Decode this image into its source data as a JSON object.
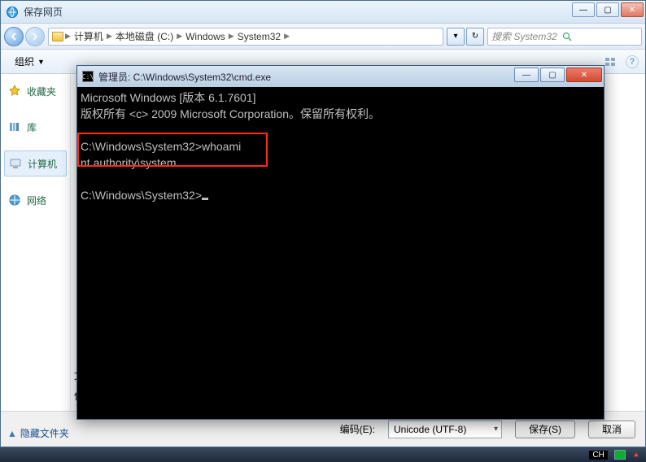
{
  "outer_window": {
    "title": "保存网页"
  },
  "nav": {
    "breadcrumb": [
      "计算机",
      "本地磁盘 (C:)",
      "Windows",
      "System32"
    ],
    "search_placeholder": "搜索 System32"
  },
  "toolbar": {
    "organize": "组织",
    "help_tip": "?"
  },
  "sidebar": {
    "items": [
      {
        "label": "收藏夹",
        "icon": "star"
      },
      {
        "label": "库",
        "icon": "library"
      },
      {
        "label": "计算机",
        "icon": "computer",
        "selected": true
      },
      {
        "label": "网络",
        "icon": "network"
      }
    ]
  },
  "main_labels": {
    "filename": "文件",
    "savetype": "保存类"
  },
  "hide_folders": "隐藏文件夹",
  "bottom": {
    "encoding_label": "编码(E):",
    "encoding_value": "Unicode (UTF-8)",
    "save": "保存(S)",
    "cancel": "取消"
  },
  "cmd": {
    "title": "管理员: C:\\Windows\\System32\\cmd.exe",
    "lines": {
      "l1": "Microsoft Windows [版本 6.1.7601]",
      "l2": "版权所有 <c> 2009 Microsoft Corporation。保留所有权利。",
      "blank1": "",
      "l3": "C:\\Windows\\System32>whoami",
      "l4": "nt authority\\system",
      "blank2": "",
      "l5": "C:\\Windows\\System32>"
    }
  },
  "taskbar": {
    "ime": "CH"
  }
}
